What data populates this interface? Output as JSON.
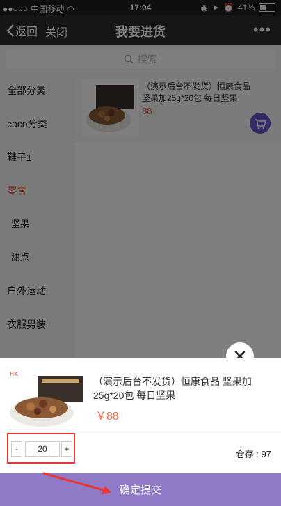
{
  "status": {
    "carrier": "中国移动",
    "time": "17:04",
    "battery": "41%",
    "battery_level": 0.41
  },
  "nav": {
    "back_label": "返回",
    "close_label": "关闭",
    "title": "我要进货",
    "more_icon": "more-icon"
  },
  "search": {
    "placeholder": "搜索"
  },
  "sidebar": {
    "items": [
      {
        "label": "全部分类"
      },
      {
        "label": "coco分类"
      },
      {
        "label": "鞋子1"
      },
      {
        "label": "零食"
      },
      {
        "label": "坚果"
      },
      {
        "label": "甜点"
      },
      {
        "label": "户外运动"
      },
      {
        "label": "衣服男装"
      }
    ]
  },
  "product_list": {
    "items": [
      {
        "name": "（演示后台不发货）恒康食品 坚果加25g*20包 每日坚果",
        "price": "88"
      }
    ]
  },
  "popup": {
    "name": "（演示后台不发货）恒康食品 坚果加25g*20包 每日坚果",
    "price": "￥88",
    "qty_minus": "-",
    "qty_plus": "+",
    "quantity": "20",
    "stock": "仓存 : 97",
    "submit_label": "确定提交"
  },
  "colors": {
    "accent": "#8f7ac7",
    "price": "#e64",
    "highlight": "#e33"
  }
}
